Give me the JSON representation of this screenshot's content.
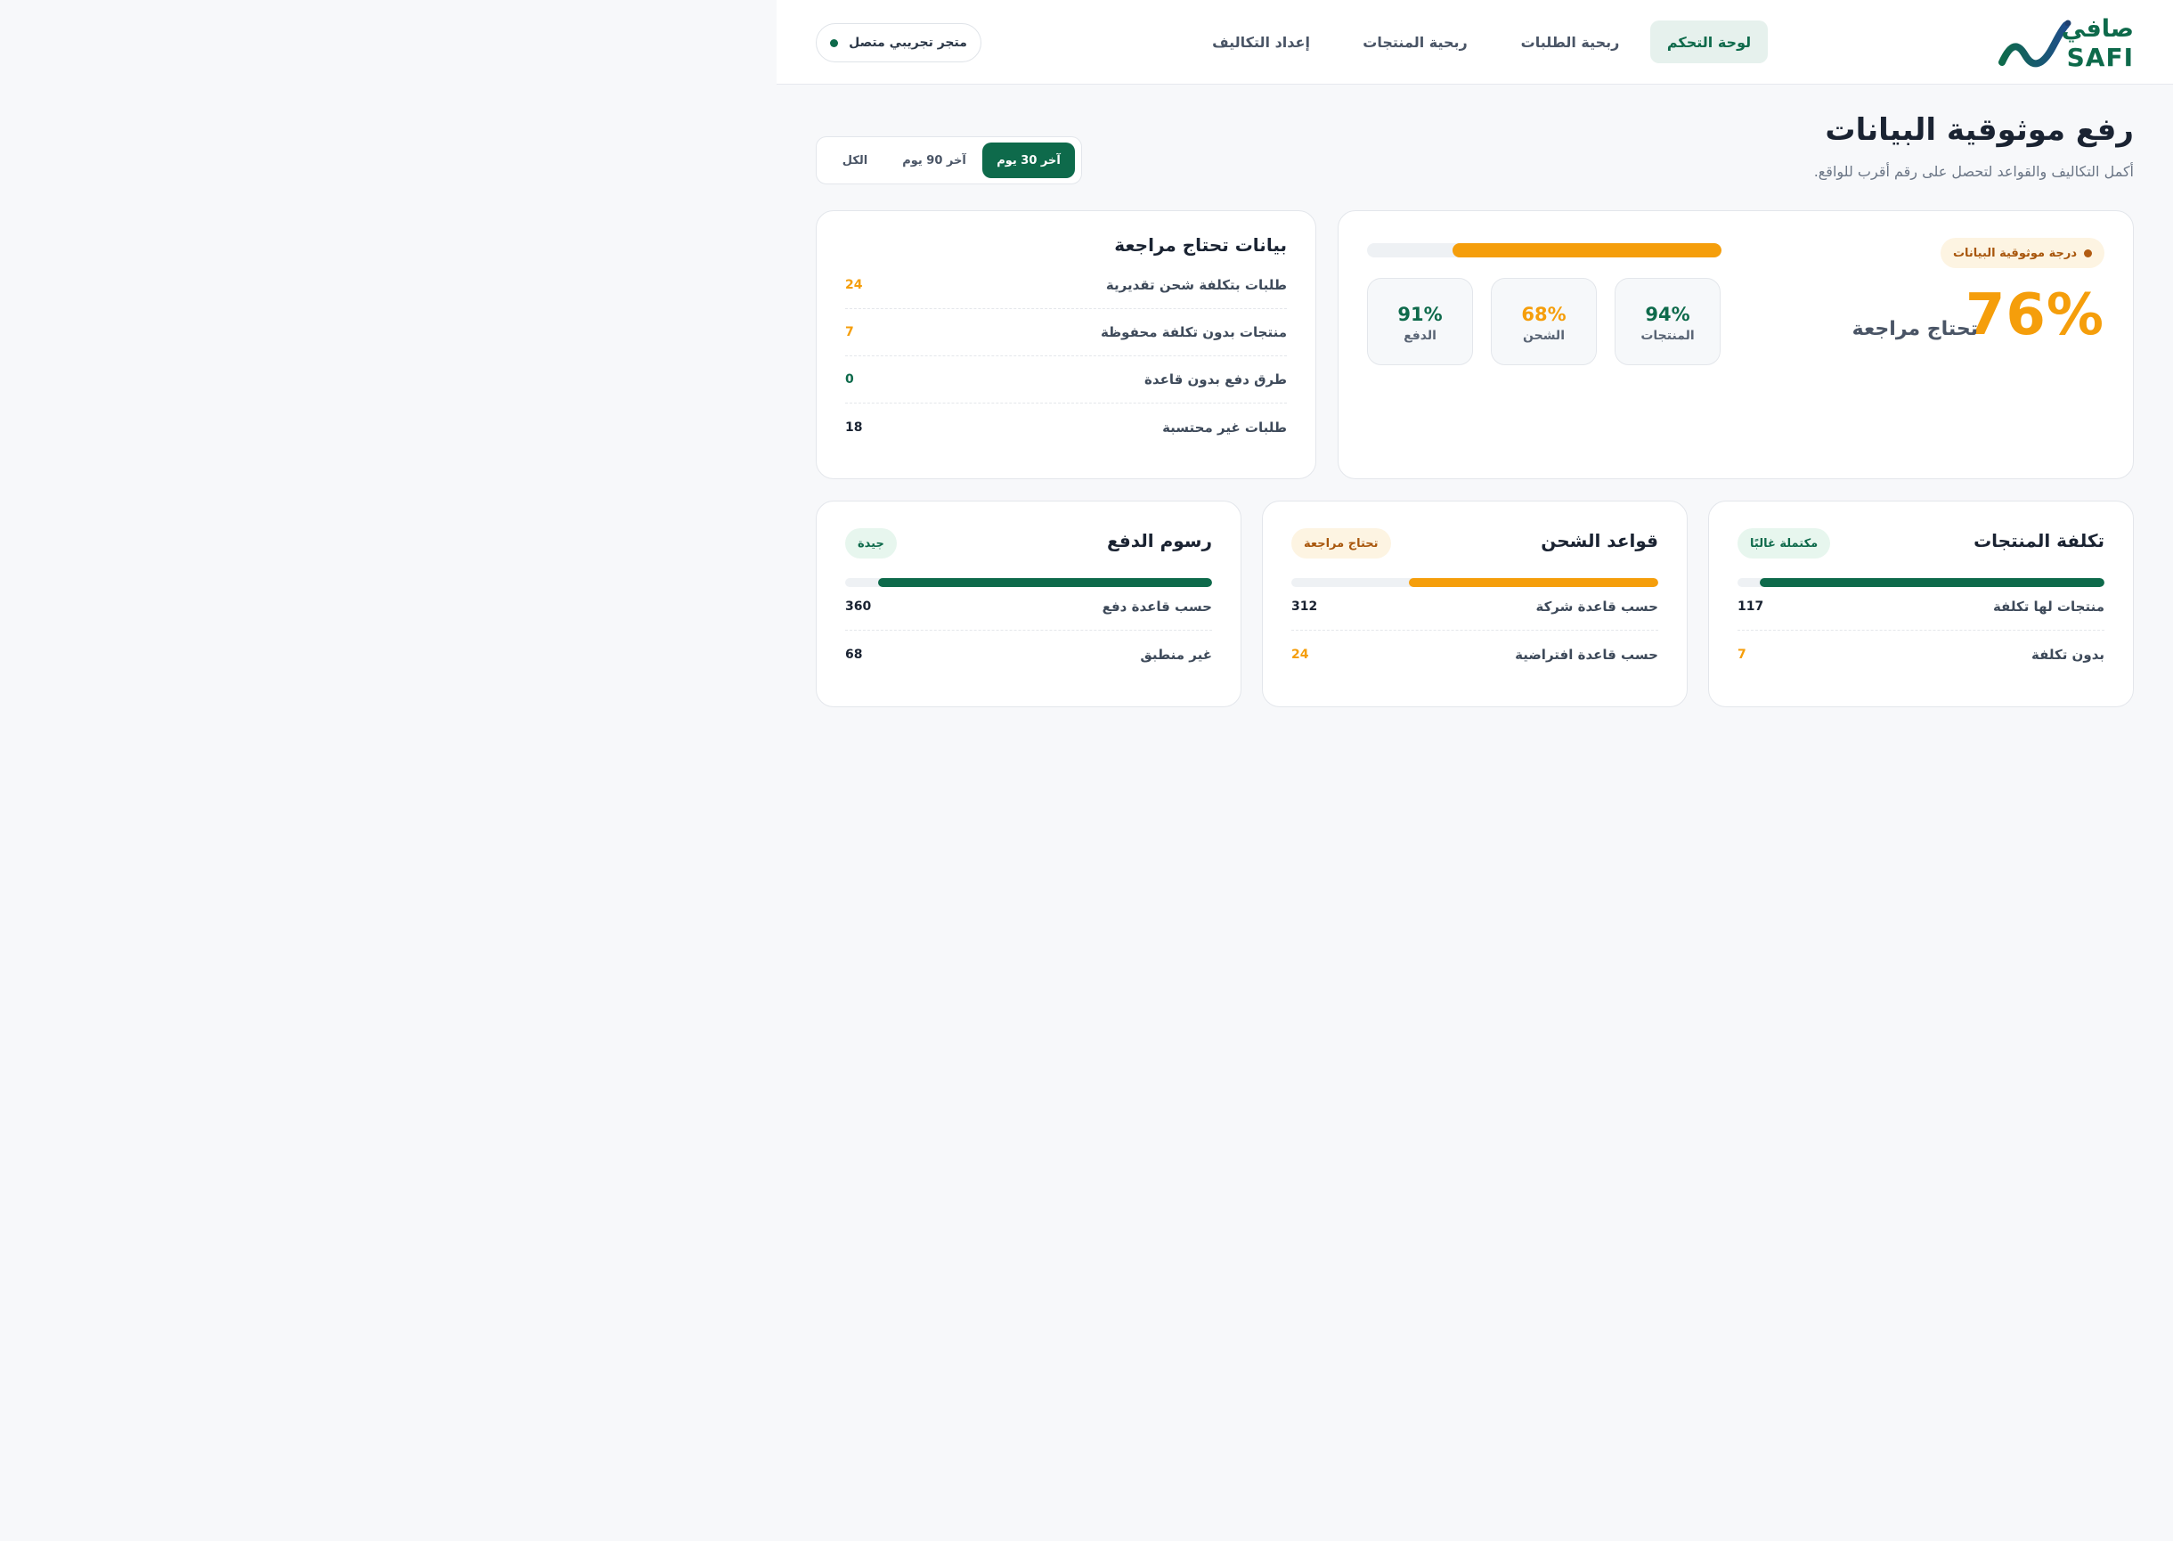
{
  "colors": {
    "primary": "#0e6a4b",
    "warning": "#f59e0b",
    "dark": "#1a2332"
  },
  "brand": {
    "name_ar": "صافي",
    "name_en": "SAFI"
  },
  "nav": {
    "items": [
      {
        "label": "لوحة التحكم",
        "active": true
      },
      {
        "label": "ربحية الطلبات"
      },
      {
        "label": "ربحية المنتجات"
      },
      {
        "label": "إعداد التكاليف"
      }
    ]
  },
  "store_status": "متجر تجريبي متصل",
  "page": {
    "title": "رفع موثوقية البيانات",
    "subtitle": "أكمل التكاليف والقواعد لتحصل على رقم أقرب للواقع."
  },
  "range_tabs": [
    {
      "label": "آخر 30 يوم",
      "active": true
    },
    {
      "label": "آخر 90 يوم"
    },
    {
      "label": "الكل"
    }
  ],
  "score": {
    "badge": "درجة موثوقية البيانات",
    "value": "76%",
    "value_pct": 76,
    "status": "تحتاج مراجعة",
    "metrics": [
      {
        "value": "94%",
        "label": "المنتجات",
        "color": "#0e6a4b"
      },
      {
        "value": "68%",
        "label": "الشحن",
        "color": "#f59e0b"
      },
      {
        "value": "91%",
        "label": "الدفع",
        "color": "#0e6a4b"
      }
    ]
  },
  "review": {
    "title": "بيانات تحتاج مراجعة",
    "rows": [
      {
        "label": "طلبات بتكلفة شحن تقديرية",
        "value": "24",
        "color": "#f59e0b"
      },
      {
        "label": "منتجات بدون تكلفة محفوظة",
        "value": "7",
        "color": "#f59e0b"
      },
      {
        "label": "طرق دفع بدون قاعدة",
        "value": "0",
        "color": "#0e6a4b"
      },
      {
        "label": "طلبات غير محتسبة",
        "value": "18",
        "color": "#1a2332"
      }
    ]
  },
  "cards": [
    {
      "title": "تكلفة المنتجات",
      "badge": "مكتملة غالبًا",
      "badge_tone": "good",
      "progress_pct": 94,
      "bar_color": "#0e6a4b",
      "rows": [
        {
          "label": "منتجات لها تكلفة",
          "value": "117",
          "color": "#1a2332"
        },
        {
          "label": "بدون تكلفة",
          "value": "7",
          "color": "#f59e0b"
        }
      ]
    },
    {
      "title": "قواعد الشحن",
      "badge": "تحتاج مراجعة",
      "badge_tone": "warn",
      "progress_pct": 68,
      "bar_color": "#f59e0b",
      "rows": [
        {
          "label": "حسب قاعدة شركة",
          "value": "312",
          "color": "#1a2332"
        },
        {
          "label": "حسب قاعدة افتراضية",
          "value": "24",
          "color": "#f59e0b"
        }
      ]
    },
    {
      "title": "رسوم الدفع",
      "badge": "جيدة",
      "badge_tone": "good",
      "progress_pct": 91,
      "bar_color": "#0e6a4b",
      "rows": [
        {
          "label": "حسب قاعدة دفع",
          "value": "360",
          "color": "#1a2332"
        },
        {
          "label": "غير منطبق",
          "value": "68",
          "color": "#1a2332"
        }
      ]
    }
  ]
}
